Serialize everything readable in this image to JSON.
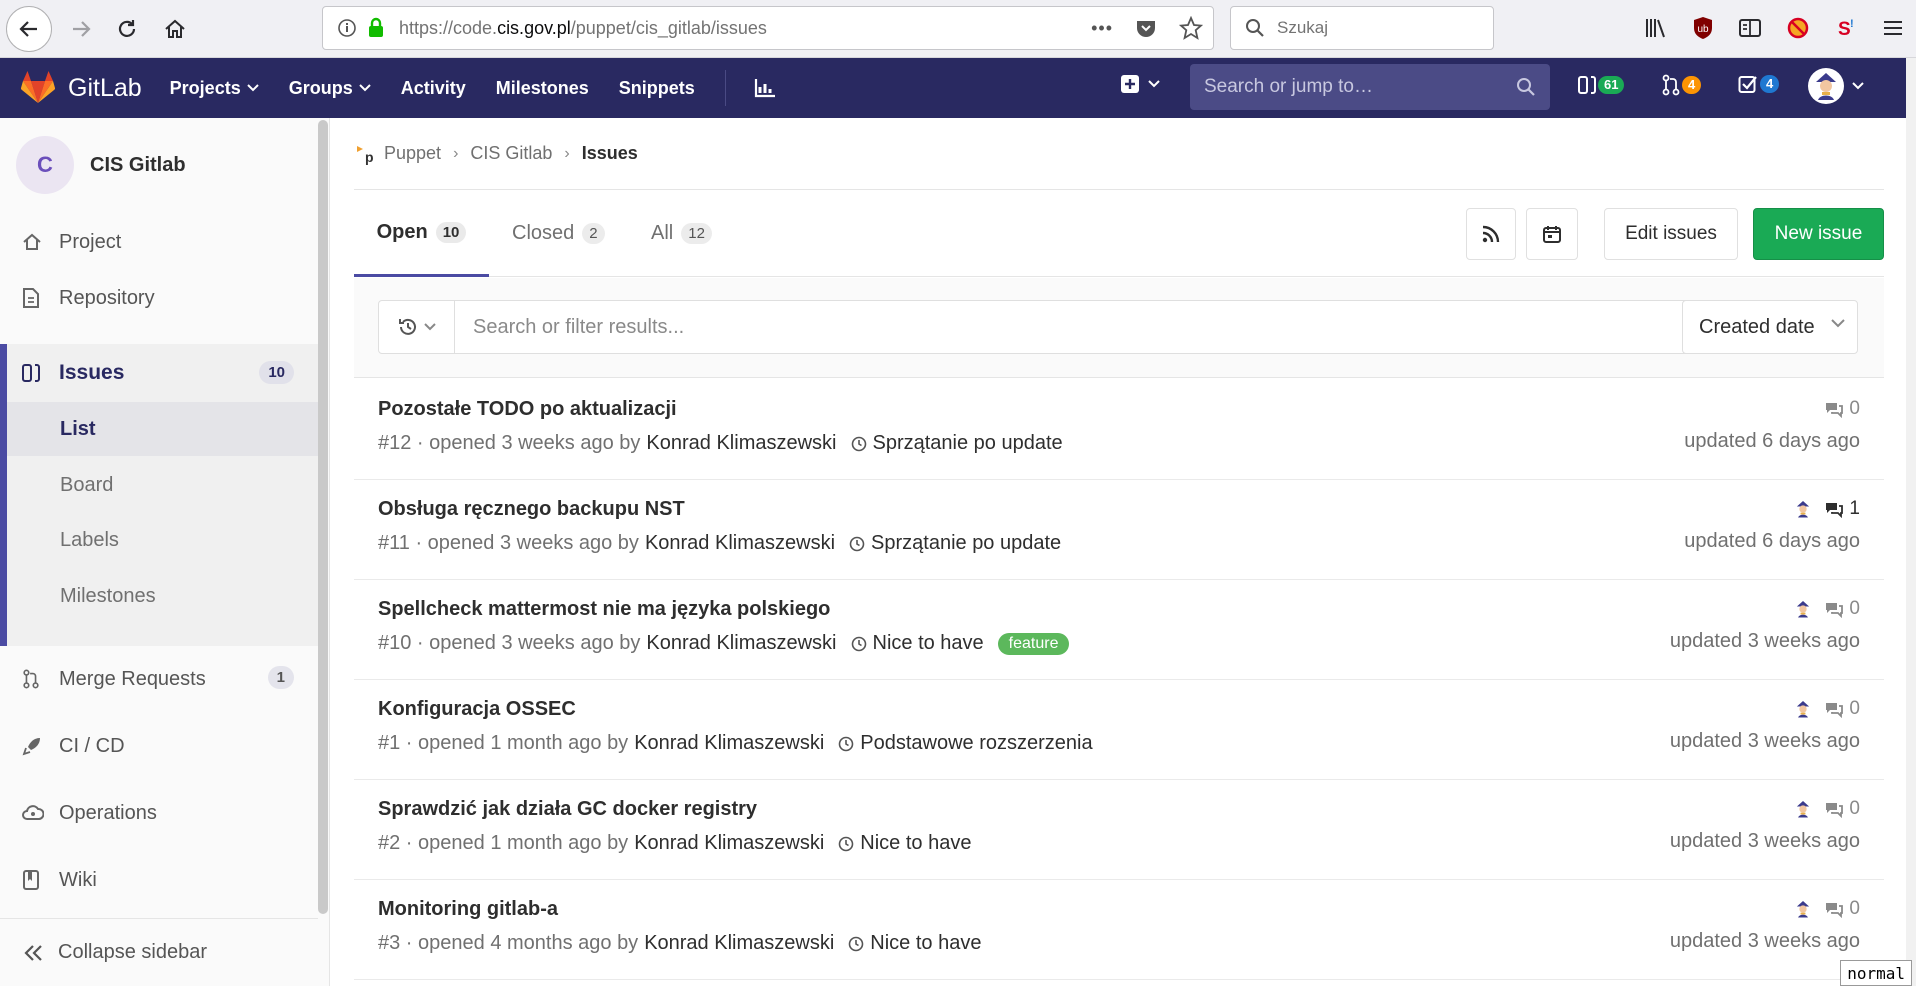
{
  "browser": {
    "url_prefix": "https://code.",
    "url_host": "cis.gov.pl",
    "url_path": "/puppet/cis_gitlab/issues",
    "search_placeholder": "Szukaj",
    "more_label": "•••"
  },
  "header": {
    "brand": "GitLab",
    "nav": [
      "Projects",
      "Groups",
      "Activity",
      "Milestones",
      "Snippets"
    ],
    "search_placeholder": "Search or jump to…",
    "counters": {
      "issues": "61",
      "merge_requests": "4",
      "todos": "4"
    },
    "colors": {
      "bg": "#292961",
      "issues_badge": "#1aaa55",
      "mr_badge": "#fc9403",
      "todo_badge": "#1f78d1"
    }
  },
  "sidebar": {
    "project_initial": "C",
    "project_name": "CIS Gitlab",
    "items": {
      "project": "Project",
      "repository": "Repository",
      "issues": "Issues",
      "issues_count": "10",
      "merge_requests": "Merge Requests",
      "merge_requests_count": "1",
      "ci_cd": "CI / CD",
      "operations": "Operations",
      "wiki": "Wiki"
    },
    "sub_items": [
      "List",
      "Board",
      "Labels",
      "Milestones"
    ],
    "collapse": "Collapse sidebar"
  },
  "breadcrumb": {
    "group": "Puppet",
    "project": "CIS Gitlab",
    "current": "Issues"
  },
  "tabs": {
    "open_label": "Open",
    "open_count": "10",
    "closed_label": "Closed",
    "closed_count": "2",
    "all_label": "All",
    "all_count": "12"
  },
  "actions": {
    "edit_issues": "Edit issues",
    "new_issue": "New issue"
  },
  "filter": {
    "placeholder": "Search or filter results...",
    "sort_label": "Created date"
  },
  "issues": [
    {
      "title": "Pozostałe TODO po aktualizacji",
      "ref": "#12 · opened 3 weeks ago by",
      "author": "Konrad Klimaszewski",
      "milestone": "Sprzątanie po update",
      "label": "",
      "assignee": false,
      "comments": "0",
      "updated": "updated 6 days ago"
    },
    {
      "title": "Obsługa ręcznego backupu NST",
      "ref": "#11 · opened 3 weeks ago by",
      "author": "Konrad Klimaszewski",
      "milestone": "Sprzątanie po update",
      "label": "",
      "assignee": true,
      "comments": "1",
      "updated": "updated 6 days ago"
    },
    {
      "title": "Spellcheck mattermost nie ma języka polskiego",
      "ref": "#10 · opened 3 weeks ago by",
      "author": "Konrad Klimaszewski",
      "milestone": "Nice to have",
      "label": "feature",
      "assignee": true,
      "comments": "0",
      "updated": "updated 3 weeks ago"
    },
    {
      "title": "Konfiguracja OSSEC",
      "ref": "#1 · opened 1 month ago by",
      "author": "Konrad Klimaszewski",
      "milestone": "Podstawowe rozszerzenia",
      "label": "",
      "assignee": true,
      "comments": "0",
      "updated": "updated 3 weeks ago"
    },
    {
      "title": "Sprawdzić jak działa GC docker registry",
      "ref": "#2 · opened 1 month ago by",
      "author": "Konrad Klimaszewski",
      "milestone": "Nice to have",
      "label": "",
      "assignee": true,
      "comments": "0",
      "updated": "updated 3 weeks ago"
    },
    {
      "title": "Monitoring gitlab-a",
      "ref": "#3 · opened 4 months ago by",
      "author": "Konrad Klimaszewski",
      "milestone": "Nice to have",
      "label": "",
      "assignee": true,
      "comments": "0",
      "updated": "updated 3 weeks ago"
    }
  ],
  "status_mode": "normal"
}
